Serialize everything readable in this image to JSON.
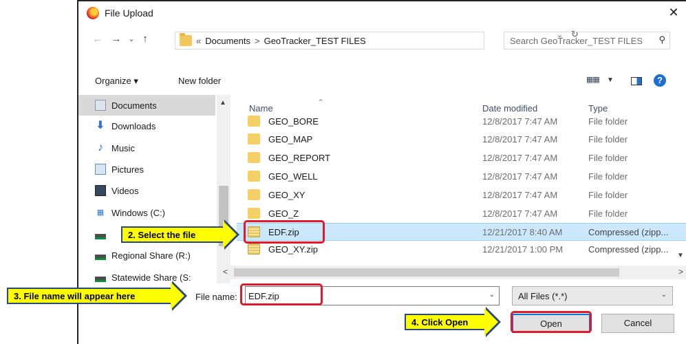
{
  "window": {
    "title": "File Upload",
    "close_glyph": "✕"
  },
  "address": {
    "back_glyph": "←",
    "forward_glyph": "→",
    "recent_glyph": "⌄",
    "up_glyph": "↑",
    "crumbs": [
      "«",
      "Documents",
      ">",
      "GeoTracker_TEST FILES"
    ],
    "dropdown_glyph": "⌄",
    "refresh_glyph": "↻",
    "search_placeholder": "Search GeoTracker_TEST FILES"
  },
  "toolbar": {
    "organize_label": "Organize ▾",
    "new_folder_label": "New folder",
    "view_glyph": "▦▦",
    "view_drop": "▼",
    "help_label": "?"
  },
  "nav_pane": {
    "items": [
      {
        "label": "Documents",
        "icon": "documents-icon",
        "selected": true
      },
      {
        "label": "Downloads",
        "icon": "downloads-icon"
      },
      {
        "label": "Music",
        "icon": "music-icon"
      },
      {
        "label": "Pictures",
        "icon": "pictures-icon"
      },
      {
        "label": "Videos",
        "icon": "videos-icon"
      },
      {
        "label": "Windows (C:)",
        "icon": "windows-drive-icon"
      },
      {
        "label": "",
        "icon": "network-drive-icon"
      },
      {
        "label": "Regional Share (R:)",
        "icon": "network-drive-icon"
      },
      {
        "label": "Statewide Share (S:",
        "icon": "network-drive-icon"
      }
    ]
  },
  "file_list": {
    "columns": {
      "name": "Name",
      "date": "Date modified",
      "type": "Type"
    },
    "rows": [
      {
        "name": "GEO_BORE",
        "date": "12/8/2017 7:47 AM",
        "type": "File folder",
        "kind": "folder"
      },
      {
        "name": "GEO_MAP",
        "date": "12/8/2017 7:47 AM",
        "type": "File folder",
        "kind": "folder"
      },
      {
        "name": "GEO_REPORT",
        "date": "12/8/2017 7:47 AM",
        "type": "File folder",
        "kind": "folder"
      },
      {
        "name": "GEO_WELL",
        "date": "12/8/2017 7:47 AM",
        "type": "File folder",
        "kind": "folder"
      },
      {
        "name": "GEO_XY",
        "date": "12/8/2017 7:47 AM",
        "type": "File folder",
        "kind": "folder"
      },
      {
        "name": "GEO_Z",
        "date": "12/8/2017 7:47 AM",
        "type": "File folder",
        "kind": "folder"
      },
      {
        "name": "EDF.zip",
        "date": "12/21/2017 8:40 AM",
        "type": "Compressed (zipp...",
        "kind": "zip",
        "selected": true
      },
      {
        "name": "GEO_XY.zip",
        "date": "12/21/2017 1:00 PM",
        "type": "Compressed (zipp...",
        "kind": "zip"
      }
    ]
  },
  "bottom": {
    "file_name_label": "File name:",
    "file_name_value": "EDF.zip",
    "filter_value": "All Files (*.*)",
    "open_label": "Open",
    "cancel_label": "Cancel"
  },
  "annotations": {
    "step2": "2. Select the file",
    "step3": "3. File name will appear here",
    "step4": "4. Click Open"
  },
  "colors": {
    "highlight": "#ffff00",
    "redbox": "#e0192c",
    "selection": "#cce8ff",
    "accent": "#0078d7"
  }
}
